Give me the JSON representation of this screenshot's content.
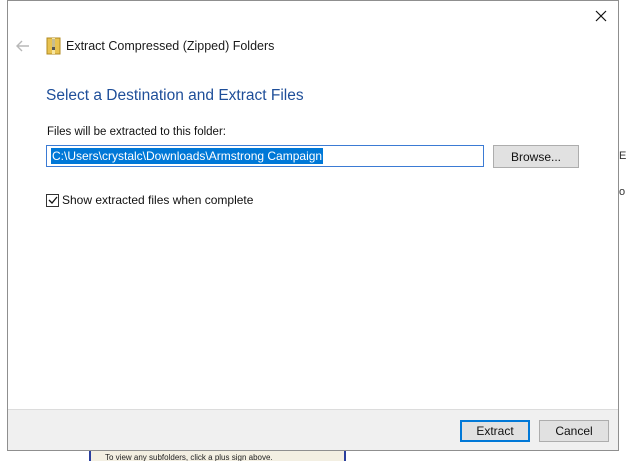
{
  "background": {
    "right_glyph_1": "E",
    "right_glyph_2": "o",
    "bottom_hint": "To view any subfolders, click a plus sign above."
  },
  "dialog": {
    "title": "Extract Compressed (Zipped) Folders",
    "heading": "Select a Destination and Extract Files",
    "path_label": "Files will be extracted to this folder:",
    "path_value": "C:\\Users\\crystalc\\Downloads\\Armstrong Campaign",
    "browse_label": "Browse...",
    "show_files_label": "Show extracted files when complete",
    "show_files_checked": true,
    "extract_label": "Extract",
    "cancel_label": "Cancel"
  },
  "icons": {
    "close": "close-icon",
    "back": "back-arrow-icon",
    "zip": "zip-folder-icon",
    "check": "checkmark-icon"
  },
  "colors": {
    "heading": "#1e4e99",
    "selection": "#0078d7",
    "footer_bg": "#f0f0f0"
  }
}
